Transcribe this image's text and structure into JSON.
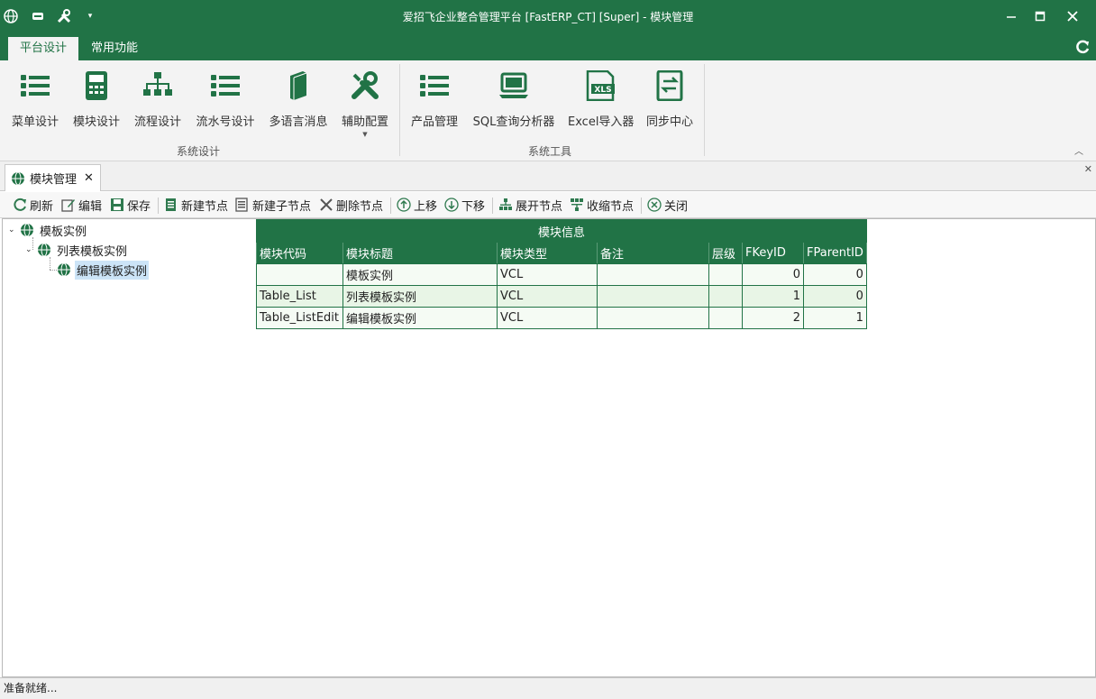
{
  "window": {
    "title": "爱招飞企业整合管理平台 [FastERP_CT] [Super] - 模块管理"
  },
  "ribbon_tabs": [
    "平台设计",
    "常用功能"
  ],
  "ribbon": {
    "groups": [
      {
        "label": "系统设计",
        "buttons": [
          "菜单设计",
          "模块设计",
          "流程设计",
          "流水号设计",
          "多语言消息",
          "辅助配置"
        ]
      },
      {
        "label": "系统工具",
        "buttons": [
          "产品管理",
          "SQL查询分析器",
          "Excel导入器",
          "同步中心"
        ]
      }
    ]
  },
  "doc_tab": {
    "label": "模块管理",
    "close": "✕"
  },
  "toolbar": [
    "刷新",
    "编辑",
    "保存",
    "新建节点",
    "新建子节点",
    "删除节点",
    "上移",
    "下移",
    "展开节点",
    "收缩节点",
    "关闭"
  ],
  "tree": [
    {
      "label": "模板实例",
      "level": 0,
      "expanded": true
    },
    {
      "label": "列表模板实例",
      "level": 1,
      "expanded": true
    },
    {
      "label": "编辑模板实例",
      "level": 2,
      "selected": true
    }
  ],
  "grid": {
    "band": "模块信息",
    "columns": [
      "模块代码",
      "模块标题",
      "模块类型",
      "备注",
      "层级",
      "FKeyID",
      "FParentID"
    ],
    "rows": [
      [
        "",
        "模板实例",
        "VCL",
        "",
        "",
        "0",
        "0"
      ],
      [
        "Table_List",
        "列表模板实例",
        "VCL",
        "",
        "",
        "1",
        "0"
      ],
      [
        "Table_ListEdit",
        "编辑模板实例",
        "VCL",
        "",
        "",
        "2",
        "1"
      ]
    ]
  },
  "status": "准备就绪...",
  "colors": {
    "accent": "#217346"
  }
}
